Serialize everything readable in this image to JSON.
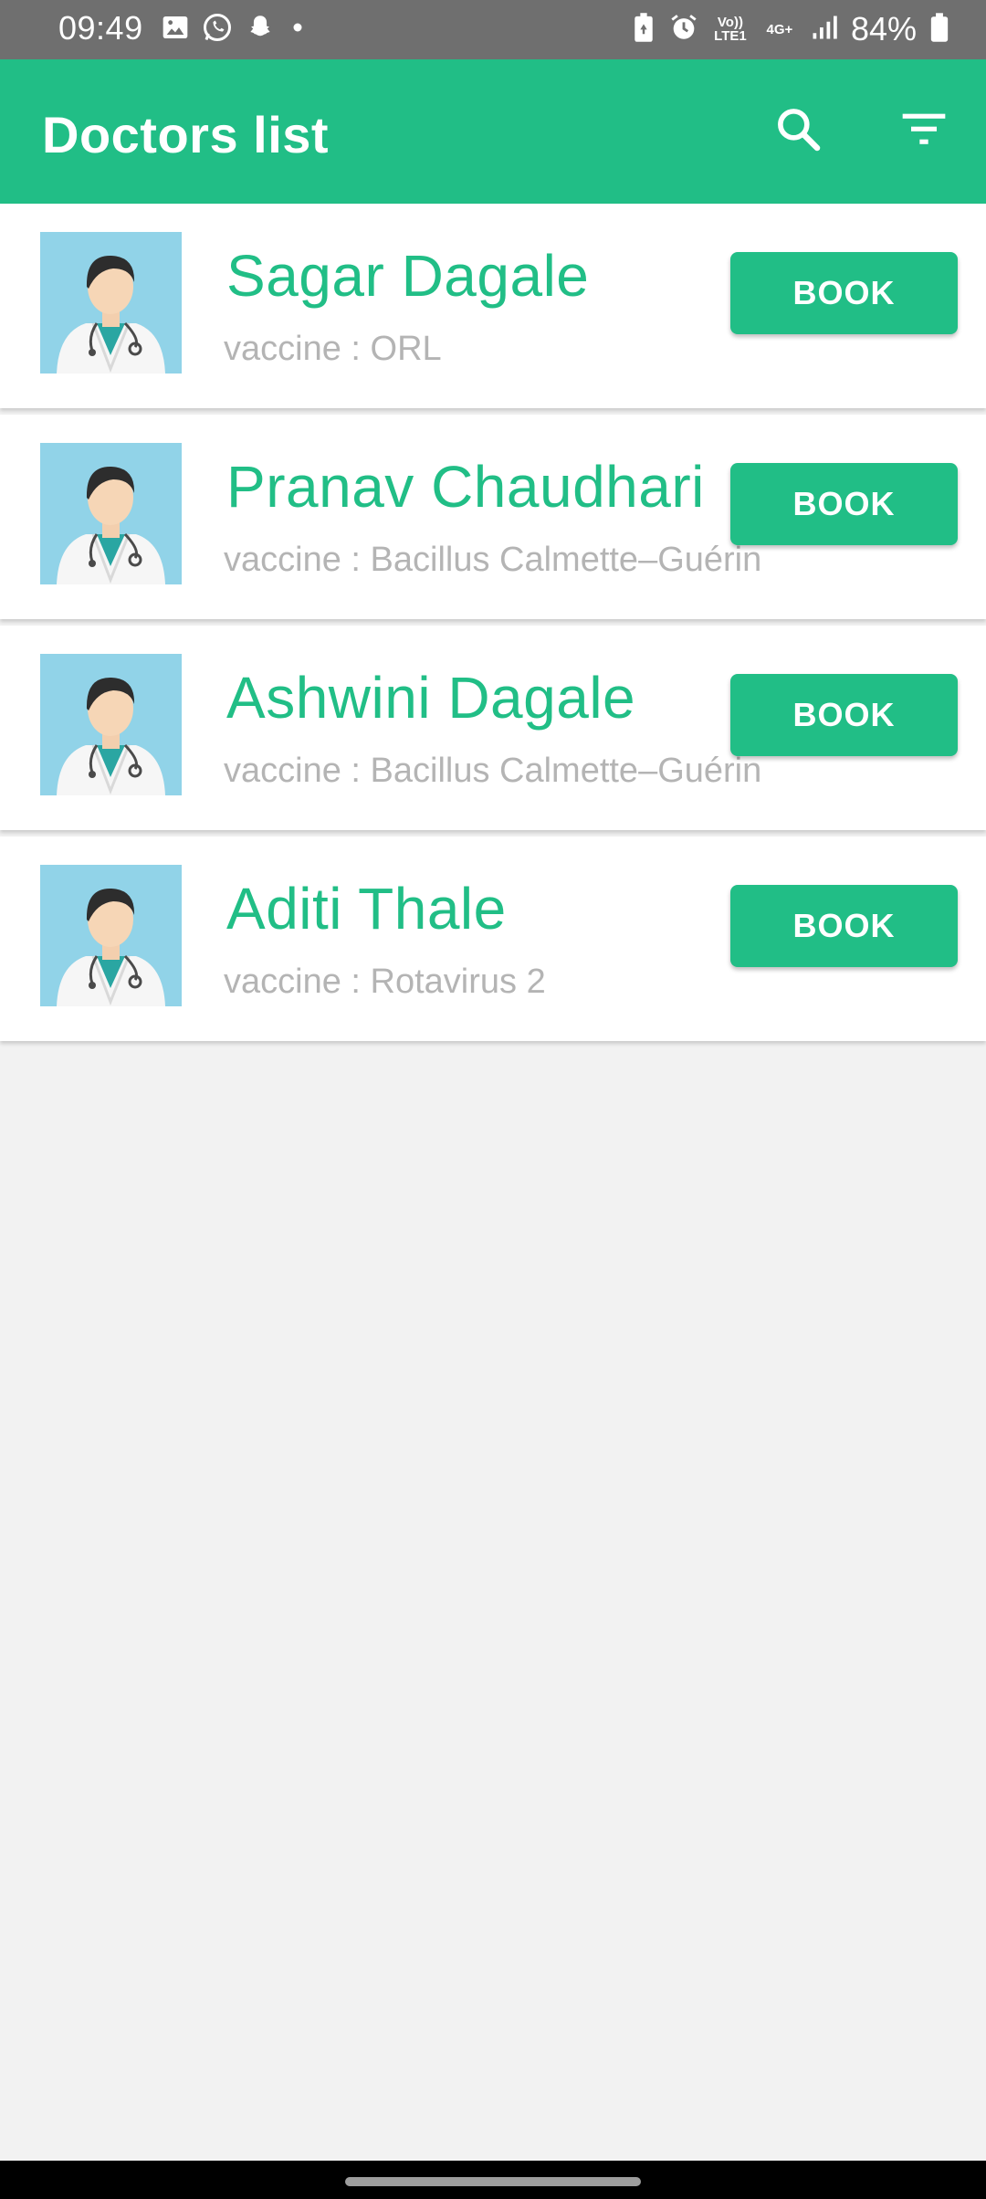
{
  "status_bar": {
    "time": "09:49",
    "left_icons": [
      "image-icon",
      "whatsapp-icon",
      "snapchat-icon",
      "dot-icon"
    ],
    "volte_label": "Vo)) LTE1",
    "network_label": "4G+",
    "battery_percent": "84%"
  },
  "app_bar": {
    "title": "Doctors list",
    "search_icon": "search-icon",
    "filter_icon": "filter-icon",
    "color": "#21be86"
  },
  "doctors": [
    {
      "name": "Sagar Dagale",
      "vaccine": "vaccine : ORL",
      "button": "BOOK"
    },
    {
      "name": "Pranav Chaudhari",
      "vaccine": "vaccine : Bacillus Calmette–Guérin",
      "button": "BOOK"
    },
    {
      "name": "Ashwini Dagale",
      "vaccine": "vaccine : Bacillus Calmette–Guérin",
      "button": "BOOK"
    },
    {
      "name": "Aditi Thale",
      "vaccine": "vaccine : Rotavirus 2",
      "button": "BOOK"
    }
  ]
}
